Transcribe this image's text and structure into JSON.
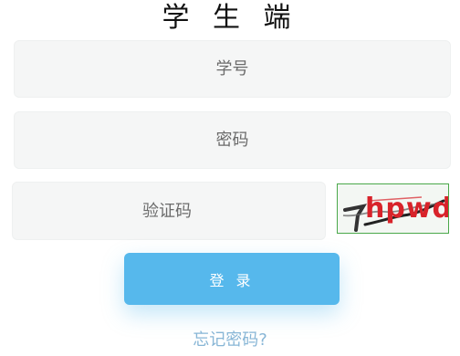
{
  "page": {
    "title": "学 生 端"
  },
  "form": {
    "student_id_placeholder": "学号",
    "password_placeholder": "密码",
    "captcha_placeholder": "验证码",
    "captcha_image_text": "hpwd",
    "login_label": "登 录",
    "forgot_label": "忘记密码?"
  },
  "colors": {
    "accent": "#56b8ec",
    "link": "#88b6d6",
    "field_bg": "#f5f6f6"
  }
}
